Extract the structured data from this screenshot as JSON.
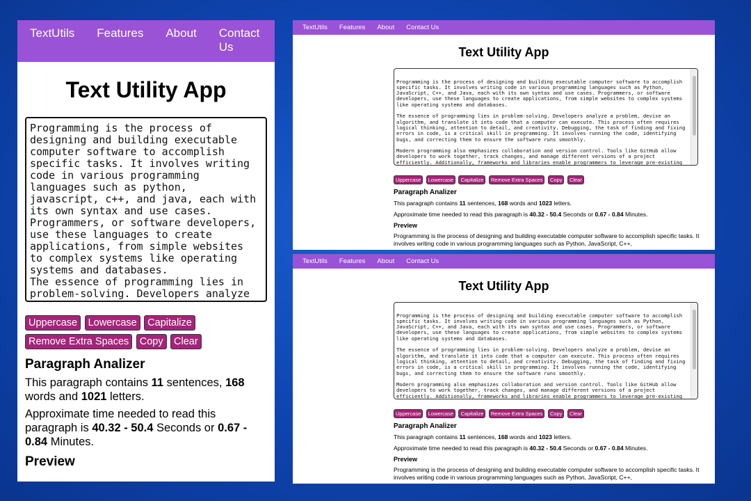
{
  "nav": {
    "brand": "TextUtils",
    "features": "Features",
    "about": "About",
    "contact": "Contact Us"
  },
  "title": "Text Utility App",
  "mobile_text": "Programming is the process of designing and building executable computer software to accomplish specific tasks. It involves writing code in various programming languages such as python, javascript, c++, and java, each with its own syntax and use cases. Programmers, or software developers, use these languages to create applications, from simple websites to complex systems like operating systems and databases.\nThe essence of programming lies in problem-solving. Developers analyze a problem, devise an algorithm, and translate it into code that a computer can execute.",
  "desktop_text": "Programming is the process of designing and building executable computer software to accomplish specific tasks. It involves writing code in various programming languages such as Python, JavaScript, C++, and Java, each with its own syntax and use cases. Programmers, or software developers, use these languages to create applications, from simple websites to complex systems like operating systems and databases.\n\nThe essence of programming lies in problem-solving. Developers analyze a problem, devise an algorithm, and translate it into code that a computer can execute. This process often requires logical thinking, attention to detail, and creativity. Debugging, the task of finding and fixing errors in code, is a critical skill in programming. It involves running the code, identifying bugs, and correcting them to ensure the software runs smoothly.\n\nModern programming also emphasizes collaboration and version control. Tools like GitHub allow developers to work together, track changes, and manage different versions of a project efficiently. Additionally, frameworks and libraries enable programmers to leverage pre-existing code, speeding up development and ensuring reliability.",
  "buttons": {
    "uppercase": "Uppercase",
    "lowercase": "Lowercase",
    "capitalize": "Capitalize",
    "remove_spaces": "Remove Extra Spaces",
    "copy": "Copy",
    "clear": "Clear"
  },
  "analyzer": {
    "heading": "Paragraph Analizer",
    "contains": "This paragraph contains",
    "sentences_label": "sentences,",
    "words_label": "words and",
    "letters_label": "letters.",
    "sentences": "11",
    "words": "168",
    "mobile_letters": "1021",
    "desktop_letters": "1023",
    "time_prefix": "Approximate time needed to read this paragraph is",
    "seconds": "40.32 - 50.4",
    "seconds_label": "Seconds or",
    "minutes": "0.67 - 0.84",
    "minutes_label": "Minutes."
  },
  "preview": {
    "heading": "Preview",
    "text": "Programming is the process of designing and building executable computer software to accomplish specific tasks. It involves writing code in various programming languages such as Python, JavaScript, C++,"
  },
  "colors": {
    "nav": "#9a52d6",
    "button": "#a5247a",
    "background": "#0f47b5"
  }
}
